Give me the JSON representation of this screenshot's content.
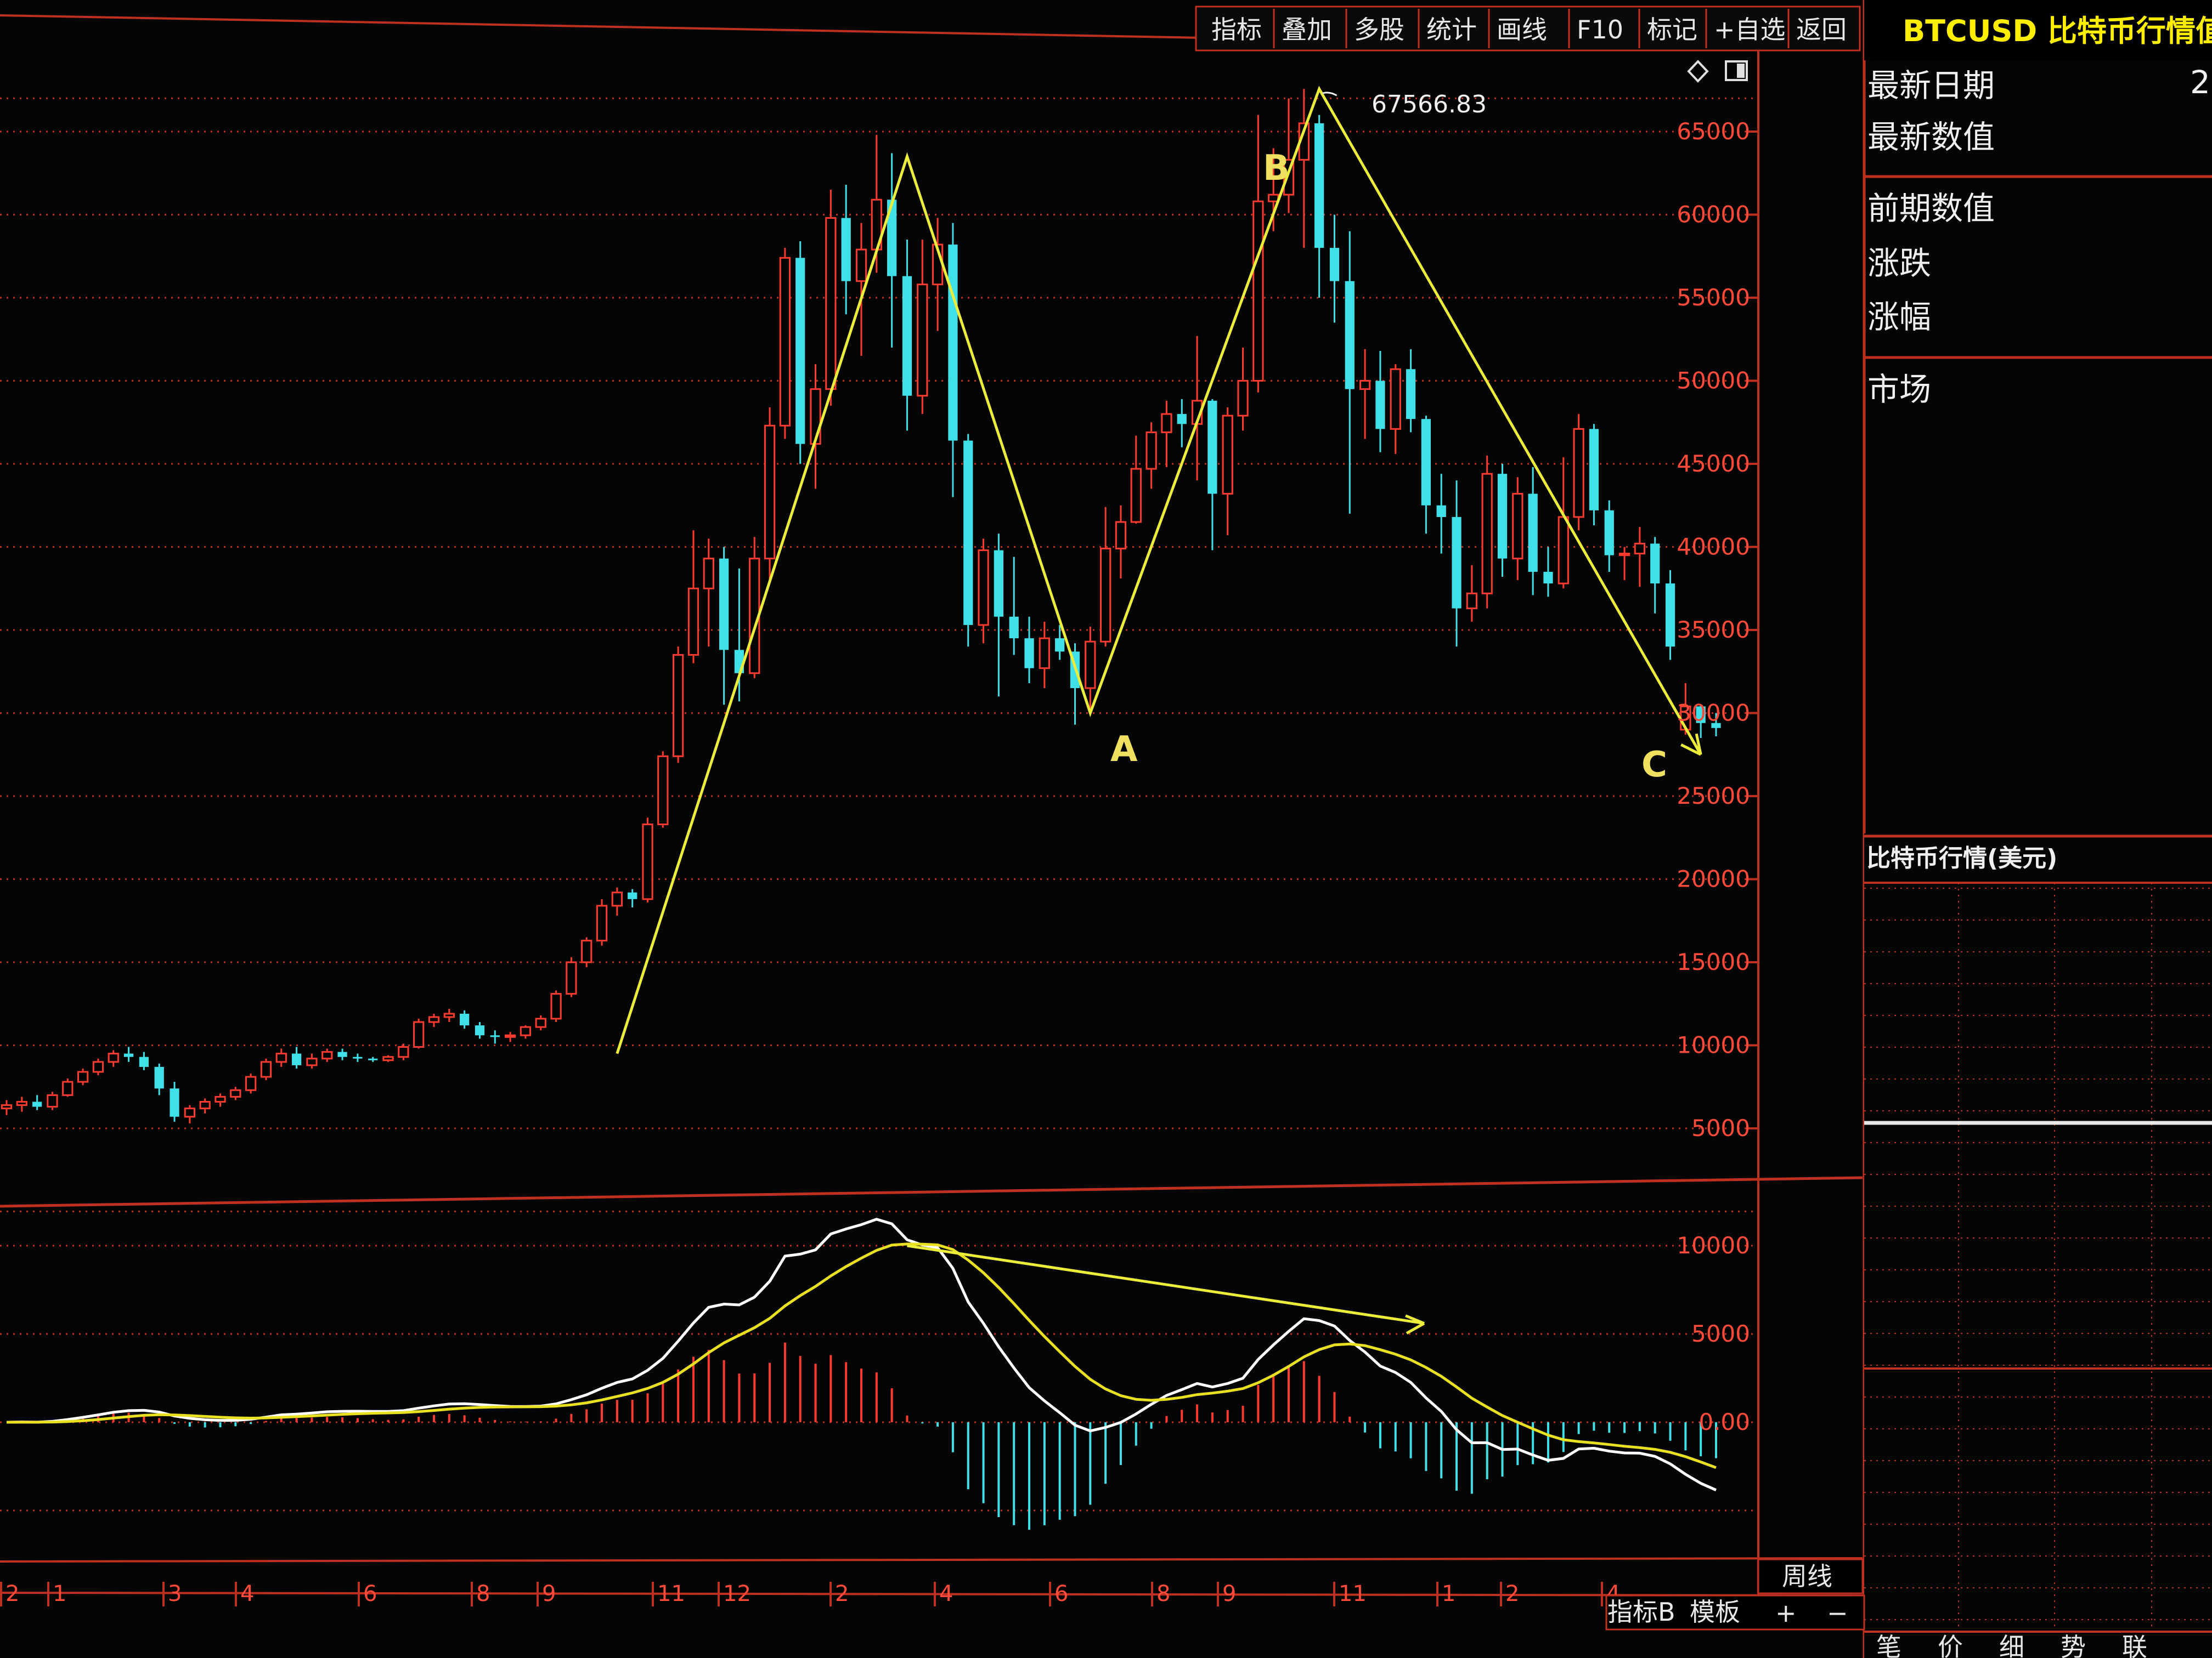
{
  "toolbar": {
    "buttons": [
      "指标",
      "叠加",
      "多股",
      "统计",
      "画线",
      "F10",
      "标记",
      "+自选",
      "返回"
    ]
  },
  "side_panel": {
    "title": "BTCUSD 比特币行情值",
    "latest_date_label": "最新日期",
    "latest_date_value": "2",
    "latest_value_label": "最新数值",
    "prev_value_label": "前期数值",
    "change_label": "涨跌",
    "change_pct_label": "涨幅",
    "market_label": "市场",
    "sub_title": "比特币行情(美元)",
    "tabs": [
      "笔",
      "价",
      "细",
      "势",
      "联"
    ]
  },
  "bottom_bar": {
    "period_label": "周线",
    "indicator_btn": "指标B",
    "template_btn": "模板",
    "zoom_in": "+",
    "zoom_out": "−"
  },
  "colors": {
    "up": "#ff3b2f",
    "down": "#3fe0e8",
    "grid": "#c03020",
    "annotation": "#ecec3a",
    "dif": "#ffffff",
    "dea": "#e8e020",
    "panel_title": "#ffee00"
  },
  "icons": [
    "diamond-icon",
    "window-icon"
  ],
  "chart_data": [
    {
      "type": "candlestick",
      "ylim": [
        0,
        70000
      ],
      "yticks": [
        5000,
        10000,
        15000,
        20000,
        25000,
        30000,
        35000,
        40000,
        45000,
        50000,
        55000,
        60000,
        65000
      ],
      "month_labels": [
        "2",
        "1",
        "3",
        "4",
        "6",
        "8",
        "9",
        "11",
        "12",
        "2",
        "4",
        "6",
        "8",
        "9",
        "11",
        "1",
        "2",
        "4"
      ],
      "peak_value": "67566.83",
      "points": [
        "A",
        "B",
        "C"
      ],
      "candles_note": "weekly candles, values in USD",
      "ohlc": [
        [
          6200,
          6700,
          5800,
          6400
        ],
        [
          6400,
          6900,
          6000,
          6600
        ],
        [
          6600,
          7000,
          6100,
          6300
        ],
        [
          6300,
          7200,
          6100,
          7000
        ],
        [
          7000,
          8000,
          6900,
          7800
        ],
        [
          7800,
          8600,
          7600,
          8400
        ],
        [
          8400,
          9200,
          8200,
          9000
        ],
        [
          9000,
          9700,
          8700,
          9500
        ],
        [
          9500,
          9900,
          9000,
          9300
        ],
        [
          9300,
          9600,
          8500,
          8700
        ],
        [
          8700,
          8900,
          7000,
          7400
        ],
        [
          7400,
          7800,
          5400,
          5700
        ],
        [
          5700,
          6400,
          5300,
          6200
        ],
        [
          6200,
          6800,
          5900,
          6600
        ],
        [
          6600,
          7100,
          6300,
          6900
        ],
        [
          6900,
          7500,
          6700,
          7300
        ],
        [
          7300,
          8300,
          7100,
          8100
        ],
        [
          8100,
          9200,
          7900,
          9000
        ],
        [
          9000,
          9800,
          8700,
          9500
        ],
        [
          9500,
          9900,
          8600,
          8800
        ],
        [
          8800,
          9500,
          8600,
          9200
        ],
        [
          9200,
          9800,
          9000,
          9600
        ],
        [
          9600,
          9800,
          9100,
          9300
        ],
        [
          9300,
          9500,
          9000,
          9200
        ],
        [
          9200,
          9300,
          9000,
          9100
        ],
        [
          9100,
          9400,
          9000,
          9300
        ],
        [
          9300,
          10100,
          9100,
          9900
        ],
        [
          9900,
          11600,
          9800,
          11400
        ],
        [
          11400,
          11900,
          11100,
          11700
        ],
        [
          11700,
          12200,
          11400,
          11900
        ],
        [
          11900,
          12100,
          11000,
          11200
        ],
        [
          11200,
          11400,
          10400,
          10600
        ],
        [
          10600,
          10900,
          10100,
          10500
        ],
        [
          10500,
          10800,
          10200,
          10600
        ],
        [
          10600,
          11200,
          10400,
          11100
        ],
        [
          11100,
          11800,
          10900,
          11600
        ],
        [
          11600,
          13300,
          11400,
          13100
        ],
        [
          13100,
          15300,
          12900,
          15000
        ],
        [
          15000,
          16500,
          14700,
          16300
        ],
        [
          16300,
          18800,
          16000,
          18400
        ],
        [
          18400,
          19500,
          17800,
          19200
        ],
        [
          19200,
          19400,
          18300,
          18800
        ],
        [
          18800,
          23700,
          18600,
          23300
        ],
        [
          23300,
          27700,
          23100,
          27400
        ],
        [
          27400,
          34000,
          27000,
          33500
        ],
        [
          33500,
          41000,
          33000,
          37500
        ],
        [
          37500,
          40500,
          34000,
          39300
        ],
        [
          39300,
          40000,
          30500,
          33800
        ],
        [
          33800,
          38700,
          30700,
          32400
        ],
        [
          32400,
          40600,
          32100,
          39300
        ],
        [
          39300,
          48400,
          38000,
          47300
        ],
        [
          47300,
          58000,
          46500,
          57400
        ],
        [
          57400,
          58400,
          45000,
          46200
        ],
        [
          46200,
          51000,
          43500,
          49500
        ],
        [
          49500,
          61500,
          48500,
          59800
        ],
        [
          59800,
          61800,
          54000,
          56000
        ],
        [
          56000,
          59500,
          51500,
          57900
        ],
        [
          57900,
          64800,
          56500,
          60900
        ],
        [
          60900,
          63700,
          52000,
          56300
        ],
        [
          56300,
          58500,
          47000,
          49100
        ],
        [
          49100,
          58500,
          48000,
          55800
        ],
        [
          55800,
          59800,
          53000,
          58200
        ],
        [
          58200,
          59500,
          43000,
          46400
        ],
        [
          46400,
          46800,
          34000,
          35300
        ],
        [
          35300,
          40500,
          34200,
          39800
        ],
        [
          39800,
          40800,
          31000,
          35800
        ],
        [
          35800,
          39400,
          33500,
          34500
        ],
        [
          34500,
          35800,
          31800,
          32700
        ],
        [
          32700,
          35500,
          31500,
          34500
        ],
        [
          34500,
          35300,
          33200,
          33700
        ],
        [
          33700,
          34200,
          29300,
          31500
        ],
        [
          31500,
          35200,
          29900,
          34300
        ],
        [
          34300,
          42400,
          34000,
          39900
        ],
        [
          39900,
          42500,
          38100,
          41500
        ],
        [
          41500,
          46700,
          41400,
          44700
        ],
        [
          44700,
          47500,
          43500,
          46900
        ],
        [
          46900,
          48800,
          44800,
          48000
        ],
        [
          48000,
          48900,
          46000,
          47400
        ],
        [
          47400,
          52700,
          44000,
          48800
        ],
        [
          48800,
          48900,
          39800,
          43200
        ],
        [
          43200,
          48400,
          40700,
          47900
        ],
        [
          47900,
          52000,
          47000,
          50000
        ],
        [
          50000,
          66000,
          49300,
          60800
        ],
        [
          60800,
          64000,
          59000,
          61200
        ],
        [
          61200,
          67000,
          60100,
          63300
        ],
        [
          63300,
          67566.83,
          58000,
          65500
        ],
        [
          65500,
          66000,
          55000,
          58000
        ],
        [
          58000,
          60000,
          53500,
          56000
        ],
        [
          56000,
          59000,
          42000,
          49500
        ],
        [
          49500,
          51900,
          46500,
          50000
        ],
        [
          50000,
          51800,
          45700,
          47100
        ],
        [
          47100,
          51000,
          45600,
          50700
        ],
        [
          50700,
          51900,
          46900,
          47700
        ],
        [
          47700,
          47900,
          40800,
          42500
        ],
        [
          42500,
          44400,
          39600,
          41800
        ],
        [
          41800,
          44000,
          34000,
          36300
        ],
        [
          36300,
          38900,
          35500,
          37200
        ],
        [
          37200,
          45500,
          36300,
          44400
        ],
        [
          44400,
          45000,
          38200,
          39300
        ],
        [
          39300,
          44200,
          38000,
          43200
        ],
        [
          43200,
          44800,
          37100,
          38500
        ],
        [
          38500,
          40000,
          37000,
          37800
        ],
        [
          37800,
          45400,
          37500,
          41800
        ],
        [
          41800,
          48000,
          41000,
          47100
        ],
        [
          47100,
          47400,
          41300,
          42200
        ],
        [
          42200,
          42800,
          38500,
          39500
        ],
        [
          39500,
          40000,
          38000,
          39600
        ],
        [
          39600,
          41200,
          37600,
          40200
        ],
        [
          40200,
          40600,
          36000,
          37800
        ],
        [
          37800,
          38600,
          33200,
          34000
        ],
        [
          29000,
          31800,
          28700,
          30400
        ],
        [
          30400,
          30500,
          28500,
          29400
        ],
        [
          29400,
          30000,
          28600,
          29100
        ]
      ]
    },
    {
      "type": "macd",
      "ylim": [
        -8000,
        12000
      ],
      "yticks": [
        10000,
        5000,
        0
      ],
      "ytick_labels": [
        "10000",
        "5000",
        "0.00"
      ]
    }
  ]
}
